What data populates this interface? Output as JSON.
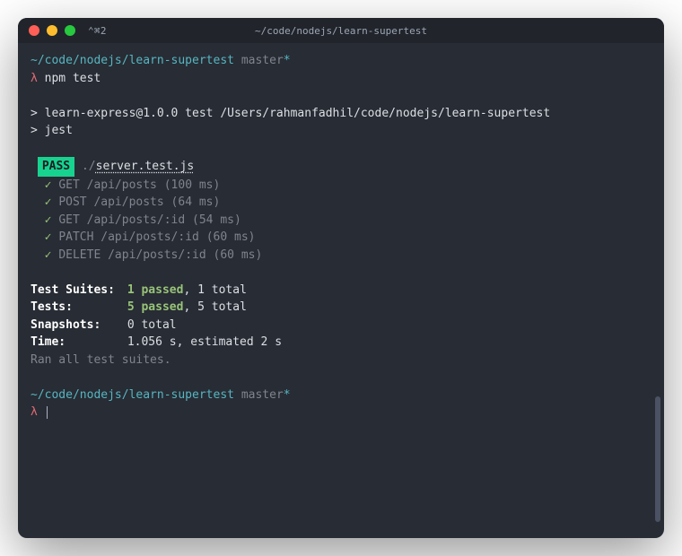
{
  "titlebar": {
    "left": "⌃⌘2",
    "center": "~/code/nodejs/learn-supertest"
  },
  "prompt": {
    "path": "~/code/nodejs/learn-supertest",
    "branch": "master",
    "dirty": "*",
    "symbol": "λ"
  },
  "command": "npm test",
  "output": {
    "line1": "> learn-express@1.0.0 test /Users/rahmanfadhil/code/nodejs/learn-supertest",
    "line2": "> jest"
  },
  "result": {
    "badge": "PASS",
    "file_prefix": "./",
    "file_name": "server.test.js",
    "tests": [
      {
        "name": "GET /api/posts",
        "time": "(100 ms)"
      },
      {
        "name": "POST /api/posts",
        "time": "(64 ms)"
      },
      {
        "name": "GET /api/posts/:id",
        "time": "(54 ms)"
      },
      {
        "name": "PATCH /api/posts/:id",
        "time": "(60 ms)"
      },
      {
        "name": "DELETE /api/posts/:id",
        "time": "(60 ms)"
      }
    ]
  },
  "summary": {
    "suites_label": "Test Suites:",
    "suites_passed": "1 passed",
    "suites_total": ", 1 total",
    "tests_label": "Tests:",
    "tests_passed": "5 passed",
    "tests_total": ", 5 total",
    "snapshots_label": "Snapshots:",
    "snapshots_value": "0 total",
    "time_label": "Time:",
    "time_value": "1.056 s, estimated 2 s",
    "footer": "Ran all test suites."
  }
}
